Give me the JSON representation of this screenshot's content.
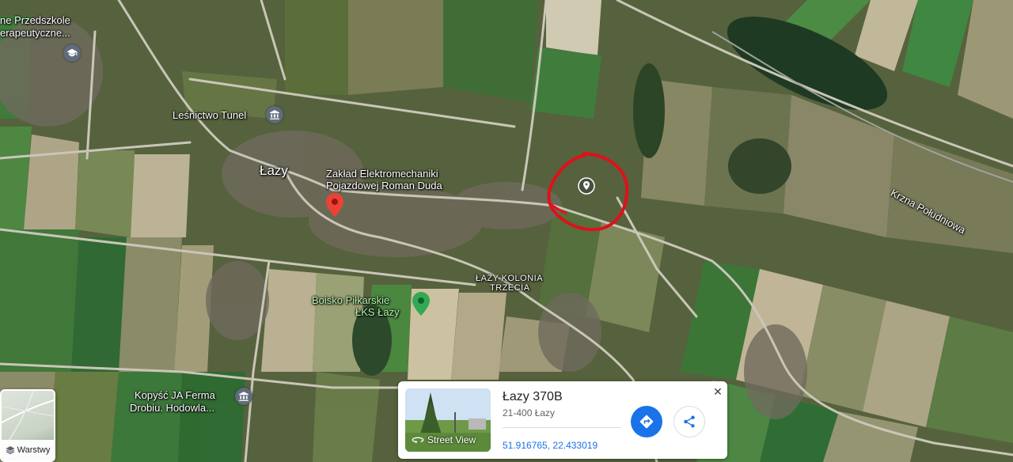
{
  "map": {
    "type": "satellite",
    "labels": {
      "przedszkole_line1": "ne Przedszkole",
      "przedszkole_line2": "erapeutyczne...",
      "lesnictwo": "Leśnictwo Tunel",
      "lazy": "Łazy",
      "zaklad_line1": "Zakład Elektromechaniki",
      "zaklad_line2": "Pojazdowej Roman Duda",
      "lazy_kolonia_line1": "ŁAZY-KOLONIA",
      "lazy_kolonia_line2": "TRZECIA",
      "boisko_line1": "Boisko Piłkarskie",
      "boisko_line2": "ŁKS Łazy",
      "kopysc_line1": "Kopyść JA Ferma",
      "kopysc_line2": "Drobiu. Hodowla...",
      "krzna": "Krzna Południowa"
    },
    "pin_colors": {
      "selected": "#ea4335",
      "place": "#5f6c7b",
      "park": "#34a853"
    },
    "annotation_color": "#e0101a"
  },
  "layers_button": {
    "label": "Warstwy",
    "icon": "layers-icon"
  },
  "place_card": {
    "title": "Łazy 370B",
    "subtitle": "21-400 Łazy",
    "coordinates": "51.916765, 22.433019",
    "street_view_label": "Street View",
    "directions_icon": "directions-icon",
    "share_icon": "share-icon",
    "close_icon": "close-icon",
    "close_glyph": "✕"
  }
}
